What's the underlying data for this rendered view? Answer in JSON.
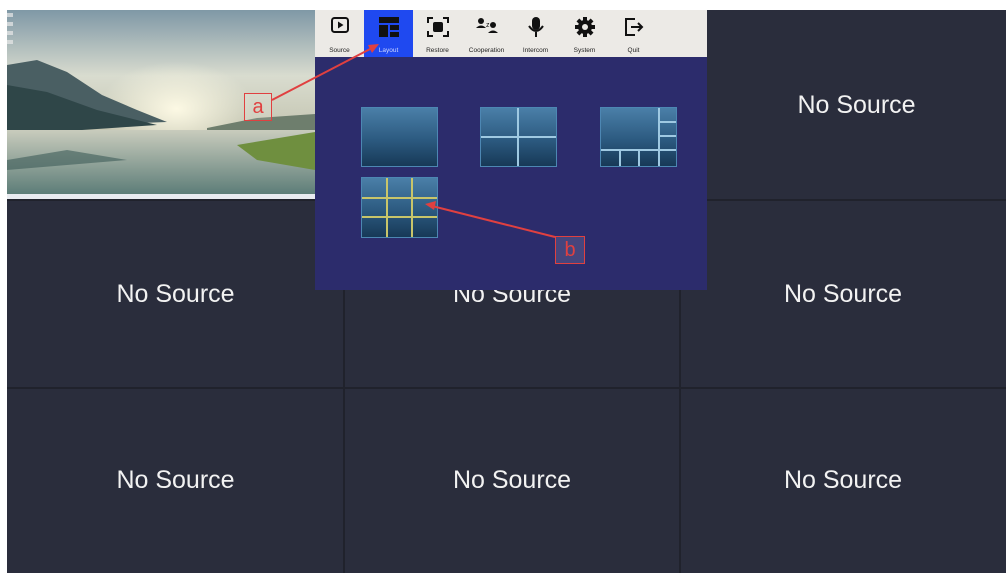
{
  "grid": {
    "cells": [
      {
        "id": "c2",
        "label": "No Source"
      },
      {
        "id": "c3",
        "label": "No Source"
      },
      {
        "id": "c4",
        "label": "No Source"
      },
      {
        "id": "c5",
        "label": "No Source"
      },
      {
        "id": "c6",
        "label": "No Source"
      },
      {
        "id": "c7",
        "label": "No Source"
      },
      {
        "id": "c8",
        "label": "No Source"
      },
      {
        "id": "c9",
        "label": "No Source"
      }
    ]
  },
  "toolbar": {
    "items": [
      {
        "label": "Source",
        "icon": "play-icon"
      },
      {
        "label": "Layout",
        "icon": "layout-icon",
        "active": true
      },
      {
        "label": "Restore",
        "icon": "restore-icon"
      },
      {
        "label": "Cooperation",
        "icon": "cooperation-icon"
      },
      {
        "label": "Intercom",
        "icon": "microphone-icon"
      },
      {
        "label": "System",
        "icon": "gear-icon"
      },
      {
        "label": "Quit",
        "icon": "exit-icon"
      }
    ],
    "active_color": "#1f49f0"
  },
  "layout_options": [
    "single-screen",
    "four-split",
    "main-plus-sub",
    "nine-split"
  ],
  "annotations": {
    "a": "a",
    "b": "b",
    "color": "#e04040"
  }
}
